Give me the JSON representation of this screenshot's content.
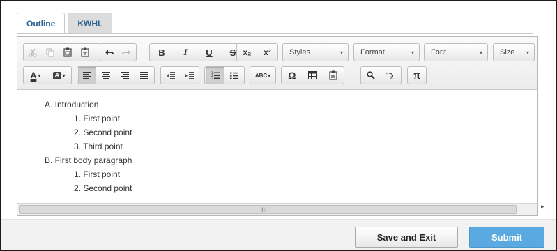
{
  "tabs": [
    {
      "label": "Outline",
      "active": true
    },
    {
      "label": "KWHL",
      "active": false
    }
  ],
  "toolbar": {
    "row1": {
      "clipboard": [
        "cut-icon",
        "copy-icon",
        "paste-icon",
        "paste-text-icon"
      ],
      "history": [
        "undo-icon",
        "redo-icon"
      ],
      "bold": "B",
      "italic": "I",
      "underline": "U",
      "strike": "S",
      "subscript": "x₂",
      "superscript": "x²",
      "styles_label": "Styles",
      "format_label": "Format",
      "font_label": "Font",
      "size_label": "Size"
    },
    "row2": {
      "text_color": "A",
      "bg_color": "A",
      "align": [
        "align-left-icon",
        "align-center-icon",
        "align-right-icon",
        "align-justify-icon"
      ],
      "indent": [
        "outdent-icon",
        "indent-icon"
      ],
      "lists": [
        "numbered-list-icon",
        "bulleted-list-icon"
      ],
      "spellcheck": "ABC",
      "special_char": "Ω",
      "pi": "π"
    }
  },
  "content": {
    "lines": [
      {
        "text": "A.  Introduction",
        "indent": 1
      },
      {
        "text": "1.  First point",
        "indent": 2
      },
      {
        "text": "2.  Second point",
        "indent": 2
      },
      {
        "text": "3.  Third point",
        "indent": 2
      },
      {
        "text": "B.  First body paragraph",
        "indent": 1
      },
      {
        "text": "1.  First point",
        "indent": 2
      },
      {
        "text": "2.  Second point",
        "indent": 2
      }
    ]
  },
  "scrollbar": {
    "grip": "III",
    "arrow": "▸"
  },
  "footer": {
    "save_exit_label": "Save and Exit",
    "submit_label": "Submit"
  },
  "colors": {
    "tab_text": "#2a6496",
    "submit_bg": "#5aa9e0",
    "border_dark": "#1a1a1a"
  }
}
